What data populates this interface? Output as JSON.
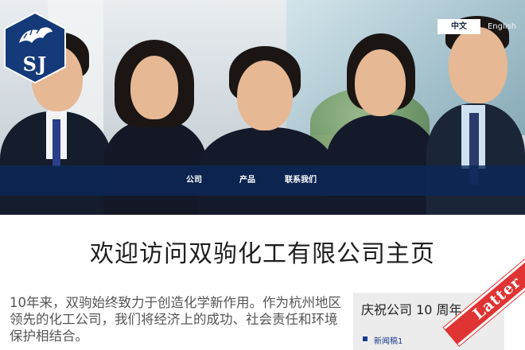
{
  "brand": {
    "logo_text": "SJ",
    "logo_color": "#143a7a"
  },
  "language": {
    "chinese": "中文",
    "english": "English"
  },
  "nav": {
    "company": "公司",
    "products": "产品",
    "contact": "联系我们",
    "bar_color": "#0a285a"
  },
  "welcome_title": "欢迎访问双驹化工有限公司主页",
  "intro_text": "10年来，双驹始终致力于创造化学新作用。作为杭州地区领先的化工公司，我们将经济上的成功、社会责任和环境保护相结合。",
  "news": {
    "title": "庆祝公司 10 周年",
    "items": [
      "新闻稿1"
    ]
  },
  "ribbon": {
    "text": "Latter",
    "color": "#e03333"
  }
}
